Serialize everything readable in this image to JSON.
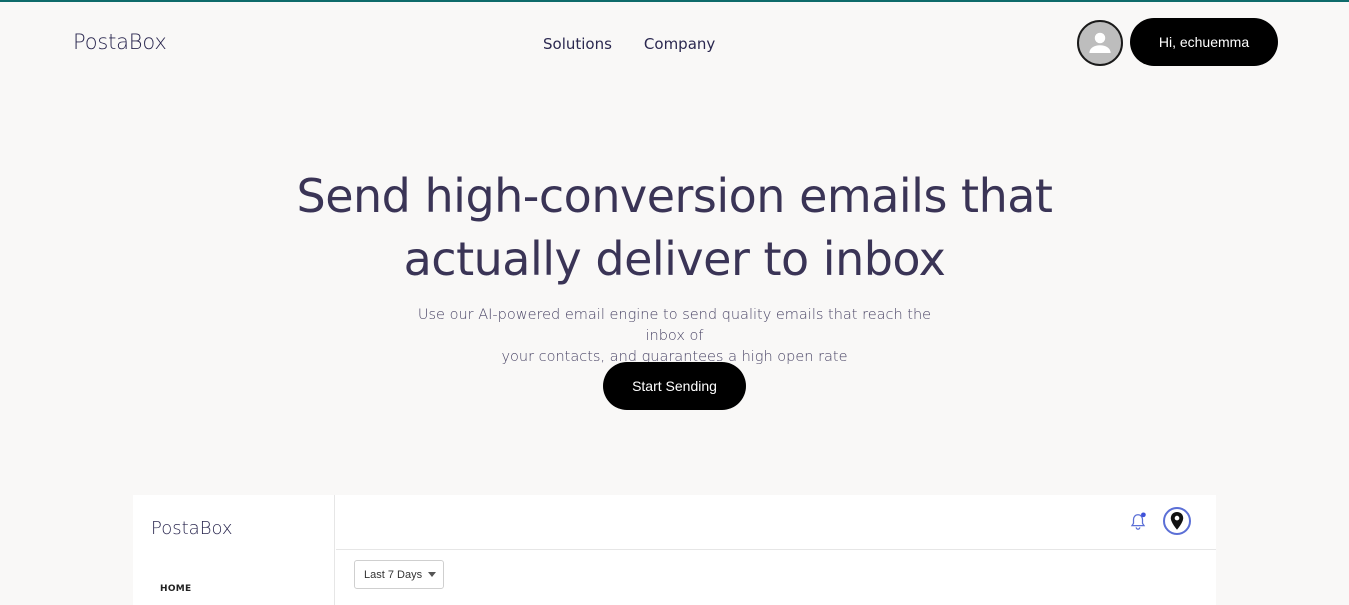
{
  "brand": {
    "name": "PostaBox"
  },
  "nav": {
    "items": [
      {
        "label": "Solutions"
      },
      {
        "label": "Company"
      }
    ]
  },
  "user": {
    "greeting": "Hi, echuemma",
    "avatar_icon": "user-avatar-icon"
  },
  "hero": {
    "title_line1": "Send high-conversion emails that",
    "title_line2": "actually deliver to inbox",
    "subtitle_line1": "Use our AI-powered email engine to send quality emails that reach the inbox of",
    "subtitle_line2": "your contacts, and guarantees a high open rate",
    "cta_label": "Start Sending"
  },
  "preview": {
    "brand": "PostaBox",
    "sidebar_home": "HOME",
    "date_range": "Last 7 Days",
    "icons": {
      "notification": "bell-icon",
      "location": "map-pin-icon"
    },
    "accent_color": "#5b6fd6"
  },
  "colors": {
    "accent_top": "#0e6b6b",
    "button_bg": "#000000",
    "heading": "#3a3456"
  }
}
